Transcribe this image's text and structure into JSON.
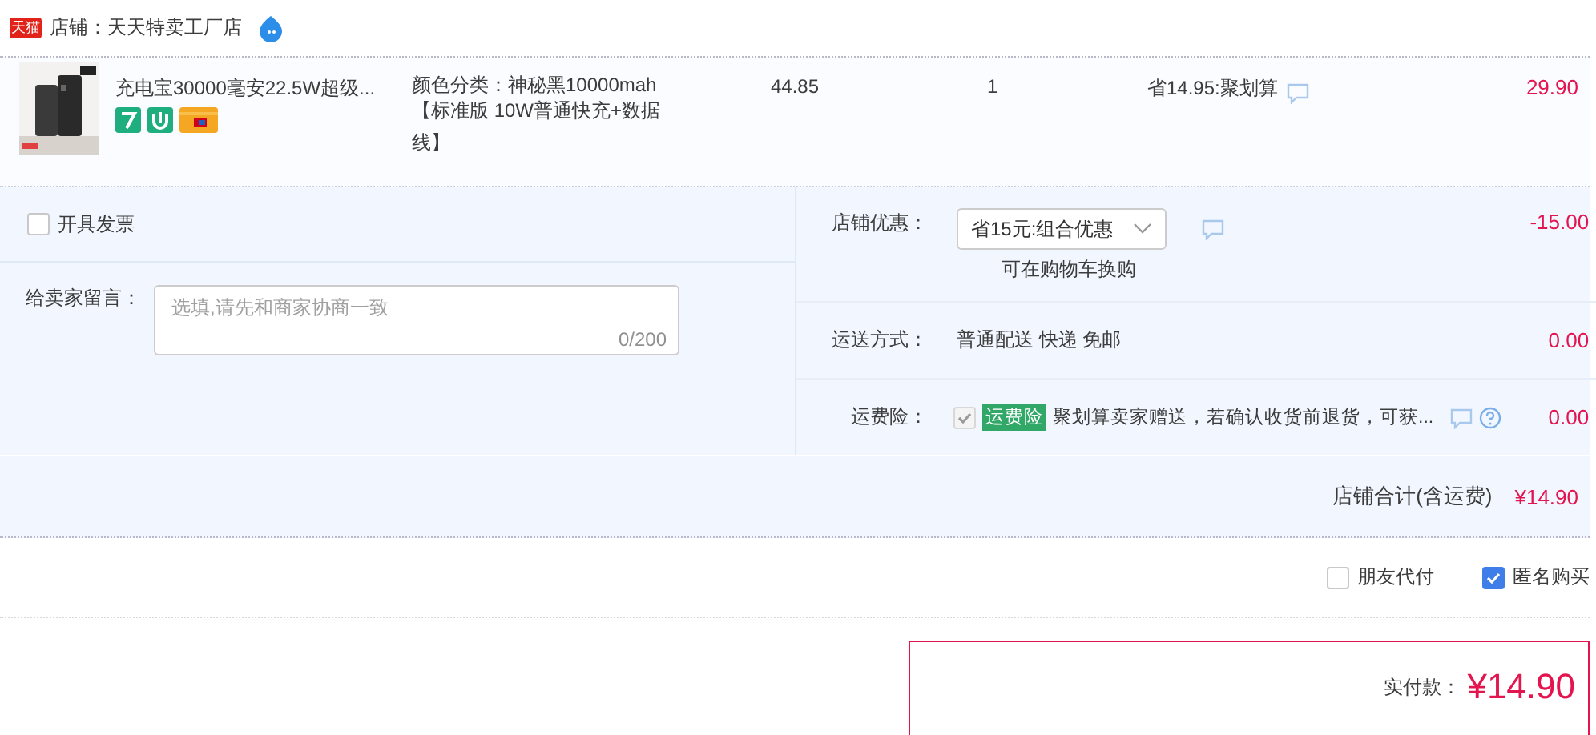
{
  "shop": {
    "badge": "天猫",
    "name": "店铺：天天特卖工厂店"
  },
  "item": {
    "title": "充电宝30000毫安22.5W超级...",
    "spec": [
      "颜色分类：神秘黑10000mah",
      "【标准版 10W普通快充+数据线】"
    ],
    "price": "44.85",
    "quantity": "1",
    "discount": "省14.95:聚划算",
    "subtotal": "29.90"
  },
  "invoice": {
    "label": "开具发票",
    "checked": false
  },
  "message": {
    "label": "给卖家留言：",
    "placeholder": "选填,请先和商家协商一致",
    "counter": "0/200"
  },
  "promo": {
    "label": "店铺优惠：",
    "value": "省15元:组合优惠",
    "note": "可在购物车换购",
    "amount": "-15.00"
  },
  "shipping": {
    "label": "运送方式：",
    "value": "普通配送 快递 免邮",
    "amount": "0.00"
  },
  "insurance": {
    "label": "运费险：",
    "checked": true,
    "disabled": true,
    "tag": "运费险",
    "text": "聚划算卖家赠送，若确认收货前退货，可获...",
    "amount": "0.00"
  },
  "total": {
    "label": "店铺合计(含运费)",
    "amount": "¥14.90"
  },
  "pay_options": [
    {
      "label": "朋友代付",
      "checked": false
    },
    {
      "label": "匿名购买",
      "checked": true
    }
  ],
  "payment": {
    "label": "实付款：",
    "amount": "¥14.90"
  }
}
